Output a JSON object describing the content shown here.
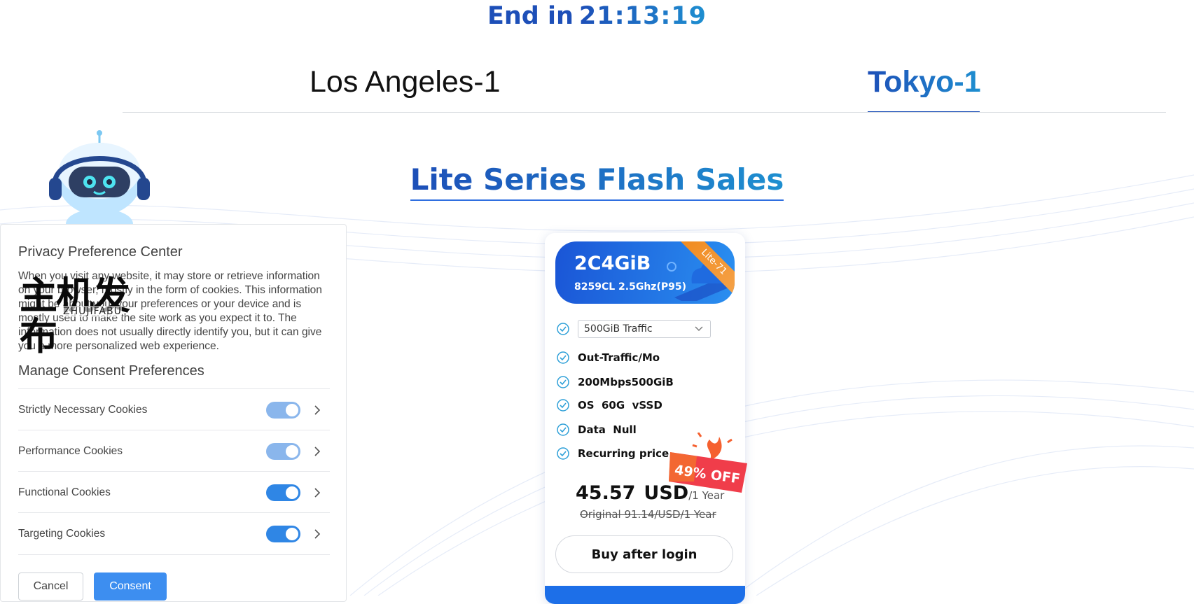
{
  "countdown": {
    "label": "End in",
    "time": "21:13:19"
  },
  "regions": {
    "tabs": [
      "Los Angeles-1",
      "Tokyo-1"
    ],
    "active": "Tokyo-1"
  },
  "section": {
    "title": "Lite Series Flash Sales"
  },
  "product": {
    "plan": "2C4GiB",
    "cpu": "8259CL 2.5Ghz(P95)",
    "ribbon": "Lite-71",
    "traffic_select": "500GiB Traffic",
    "features": [
      "Out-Traffic/Mo",
      "200Mbps500GiB",
      "OS  60G  vSSD",
      "Data  Null",
      "Recurring price"
    ],
    "price": "45.57",
    "currency": "USD",
    "period": "/1 Year",
    "original": "Original 91.14/USD/1 Year",
    "discount": "49% OFF",
    "buy_label": "Buy after login"
  },
  "privacy": {
    "title": "Privacy Preference Center",
    "description": "When you visit any website, it may store or retrieve information on your browser, mostly in the form of cookies. This information might be about you, your preferences or your device and is mostly used to make the site work as you expect it to. The information does not usually directly identify you, but it can give you a more personalized web experience.",
    "manage_title": "Manage Consent Preferences",
    "cookies": [
      {
        "name": "Strictly Necessary Cookies",
        "state": "locked"
      },
      {
        "name": "Performance Cookies",
        "state": "locked"
      },
      {
        "name": "Functional Cookies",
        "state": "on"
      },
      {
        "name": "Targeting Cookies",
        "state": "on"
      }
    ],
    "cancel_label": "Cancel",
    "consent_label": "Consent"
  },
  "watermark": {
    "cn": "主机发布",
    "en": "ZHUJIFABU"
  },
  "colors": {
    "brand_blue": "#1d4fb8",
    "accent_blue": "#1e8fd0",
    "toggle_on": "#2f86e5",
    "badge_red": "#f03d4a",
    "ribbon_orange": "#f08a1e"
  }
}
